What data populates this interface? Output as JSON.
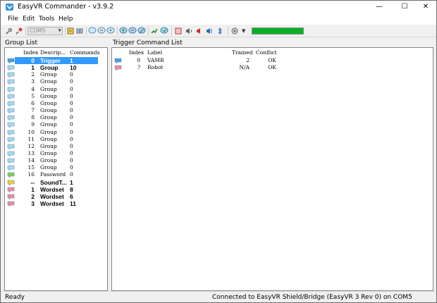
{
  "window": {
    "title": "EasyVR Commander - v3.9.2"
  },
  "menu": [
    "File",
    "Edit",
    "Tools",
    "Help"
  ],
  "toolbar": {
    "port": "COM5",
    "progress_percent": 100,
    "progress_color": "#06b025"
  },
  "left_panel": {
    "title": "Group List",
    "columns": [
      "Index",
      "Descrip...",
      "Commands"
    ],
    "rows": [
      {
        "index": "0",
        "description": "Trigger",
        "commands": "1",
        "style": "bold",
        "selected": true,
        "icon": "speech-bubble-blue"
      },
      {
        "index": "1",
        "description": "Group",
        "commands": "10",
        "style": "bold",
        "icon": "speech-bubble-light-blue"
      },
      {
        "index": "2",
        "description": "Group",
        "commands": "0",
        "icon": "speech-bubble-light-blue"
      },
      {
        "index": "3",
        "description": "Group",
        "commands": "0",
        "icon": "speech-bubble-light-blue"
      },
      {
        "index": "4",
        "description": "Group",
        "commands": "0",
        "icon": "speech-bubble-light-blue"
      },
      {
        "index": "5",
        "description": "Group",
        "commands": "0",
        "icon": "speech-bubble-light-blue"
      },
      {
        "index": "6",
        "description": "Group",
        "commands": "0",
        "icon": "speech-bubble-light-blue"
      },
      {
        "index": "7",
        "description": "Group",
        "commands": "0",
        "icon": "speech-bubble-light-blue"
      },
      {
        "index": "8",
        "description": "Group",
        "commands": "0",
        "icon": "speech-bubble-light-blue"
      },
      {
        "index": "9",
        "description": "Group",
        "commands": "0",
        "icon": "speech-bubble-light-blue"
      },
      {
        "index": "10",
        "description": "Group",
        "commands": "0",
        "icon": "speech-bubble-light-blue"
      },
      {
        "index": "11",
        "description": "Group",
        "commands": "0",
        "icon": "speech-bubble-light-blue"
      },
      {
        "index": "12",
        "description": "Group",
        "commands": "0",
        "icon": "speech-bubble-light-blue"
      },
      {
        "index": "13",
        "description": "Group",
        "commands": "0",
        "icon": "speech-bubble-light-blue"
      },
      {
        "index": "14",
        "description": "Group",
        "commands": "0",
        "icon": "speech-bubble-light-blue"
      },
      {
        "index": "15",
        "description": "Group",
        "commands": "0",
        "icon": "speech-bubble-light-blue"
      },
      {
        "index": "16",
        "description": "Password",
        "commands": "0",
        "icon": "speech-bubble-green"
      },
      {
        "index": "--",
        "description": "SoundT...",
        "commands": "1",
        "style": "bold",
        "icon": "speech-bubble-yellow"
      },
      {
        "index": "1",
        "description": "Wordset",
        "commands": "8",
        "style": "bold",
        "icon": "speech-bubble-pink"
      },
      {
        "index": "2",
        "description": "Wordset",
        "commands": "6",
        "style": "bold",
        "icon": "speech-bubble-pink"
      },
      {
        "index": "3",
        "description": "Wordset",
        "commands": "11",
        "style": "bold",
        "icon": "speech-bubble-pink"
      }
    ]
  },
  "right_panel": {
    "title": "Trigger Command List",
    "columns": [
      "Index",
      "Label",
      "Trained",
      "Conflict"
    ],
    "rows": [
      {
        "index": "0",
        "label": "VAMR",
        "trained": "2",
        "conflict": "OK",
        "icon": "speech-bubble-blue"
      },
      {
        "index": "?",
        "label": "Robot",
        "trained": "N/A",
        "conflict": "OK",
        "icon": "speech-bubble-pink"
      }
    ]
  },
  "status": {
    "left": "Ready",
    "right": "Connected to EasyVR Shield/Bridge (EasyVR 3 Rev 0) on COM5"
  },
  "colors": {
    "speech-bubble-blue": "#4a9fe0",
    "speech-bubble-light-blue": "#a8d8f0",
    "speech-bubble-green": "#7ccf5a",
    "speech-bubble-yellow": "#e8d23a",
    "speech-bubble-pink": "#f08aa0"
  }
}
